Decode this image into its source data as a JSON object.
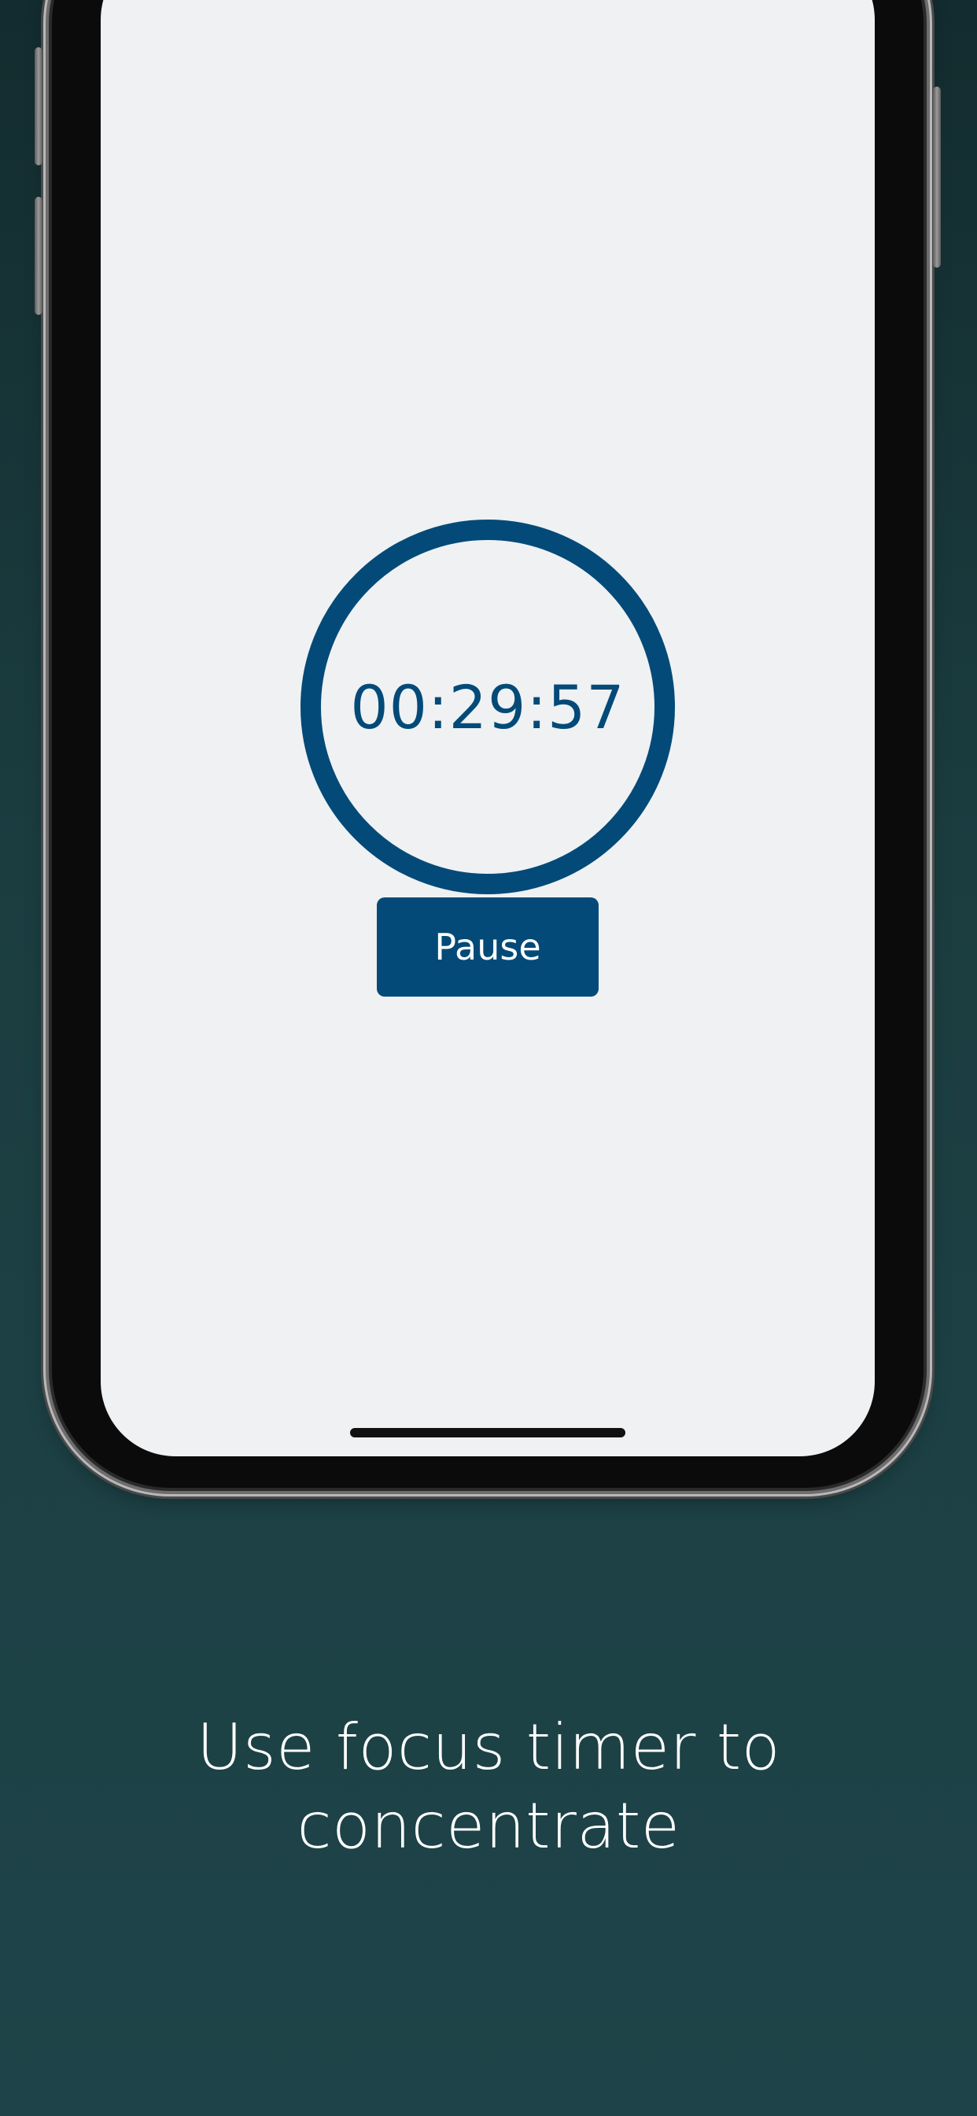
{
  "timer": {
    "display": "00:29:57"
  },
  "controls": {
    "pause_label": "Pause"
  },
  "caption": {
    "line1": "Use focus timer to",
    "line2": "concentrate"
  },
  "colors": {
    "accent": "#034a78",
    "screen_bg": "#eff1f3",
    "page_bg_top": "#132c2f",
    "page_bg_bottom": "#1e4449"
  }
}
